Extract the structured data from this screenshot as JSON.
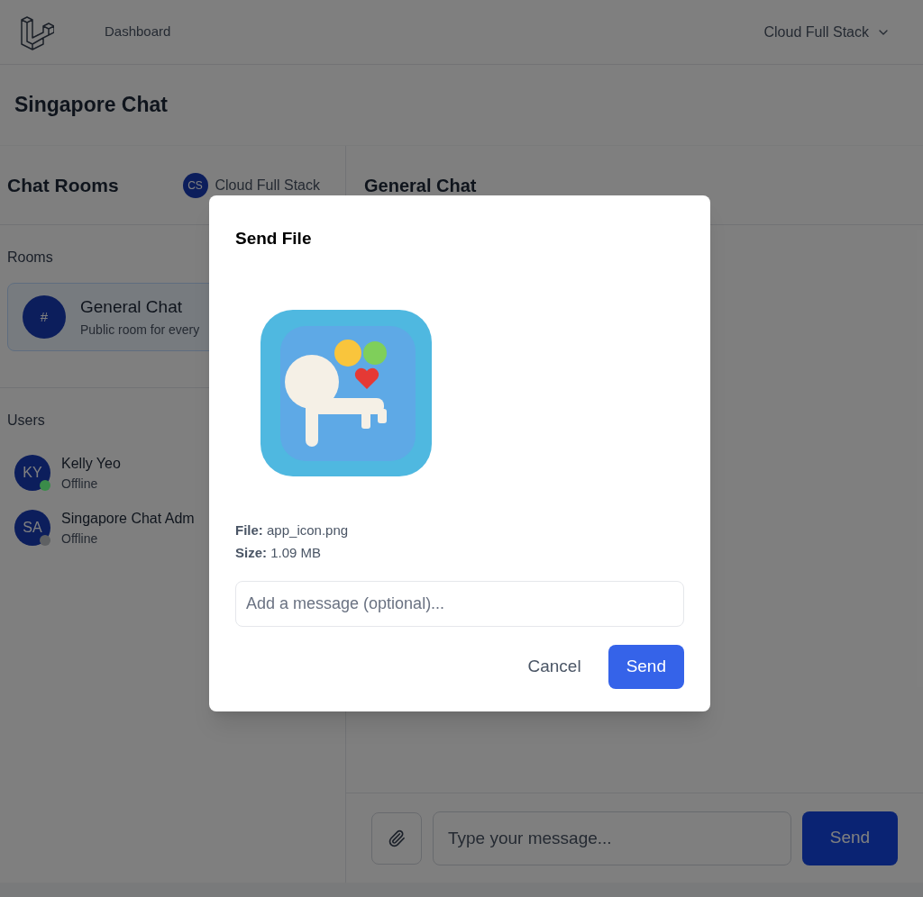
{
  "nav": {
    "links": [
      "Dashboard"
    ],
    "user_menu": "Cloud Full Stack"
  },
  "page_title": "Singapore Chat",
  "sidebar": {
    "title": "Chat Rooms",
    "user": {
      "initials": "CS",
      "name": "Cloud Full Stack"
    },
    "rooms_heading": "Rooms",
    "rooms": [
      {
        "icon": "#",
        "name": "General Chat",
        "description": "Public room for every",
        "selected": true
      }
    ],
    "users_heading": "Users",
    "users": [
      {
        "initials": "KY",
        "name": "Kelly Yeo",
        "status": "Offline",
        "color": "#3b8c4a"
      },
      {
        "initials": "SA",
        "name": "Singapore Chat Adm",
        "status": "Offline",
        "color": "#5f6163"
      }
    ]
  },
  "chat": {
    "title": "General Chat",
    "composer": {
      "placeholder": "Type your message...",
      "send": "Send"
    }
  },
  "dialog": {
    "title": "Send File",
    "details": [
      {
        "label": "File:",
        "value": "app_icon.png"
      },
      {
        "label": "Size:",
        "value": "1.09 MB"
      }
    ],
    "message": {
      "placeholder": "Add a message (optional)..."
    },
    "buttons": [
      {
        "label": "Cancel",
        "kind": "secondary"
      },
      {
        "label": "Send",
        "kind": "primary"
      }
    ]
  }
}
